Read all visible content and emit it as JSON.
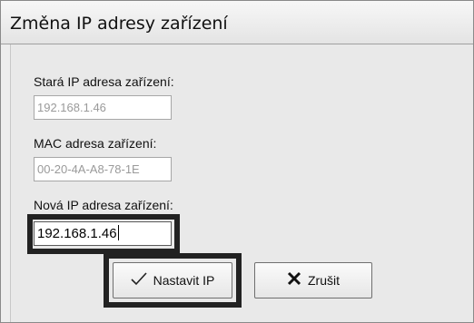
{
  "window": {
    "title": "Změna IP adresy zařízení"
  },
  "old_ip": {
    "label": "Stará IP adresa zařízení:",
    "value": "192.168.1.46"
  },
  "mac": {
    "label": "MAC adresa zařízení:",
    "value": "00-20-4A-A8-78-1E"
  },
  "new_ip": {
    "label": "Nová IP adresa zařízení:",
    "value": "192.168.1.46"
  },
  "buttons": {
    "set_ip": {
      "label": "Nastavit IP",
      "icon": "checkmark-icon"
    },
    "cancel": {
      "label": "Zrušit",
      "icon": "x-icon"
    }
  }
}
